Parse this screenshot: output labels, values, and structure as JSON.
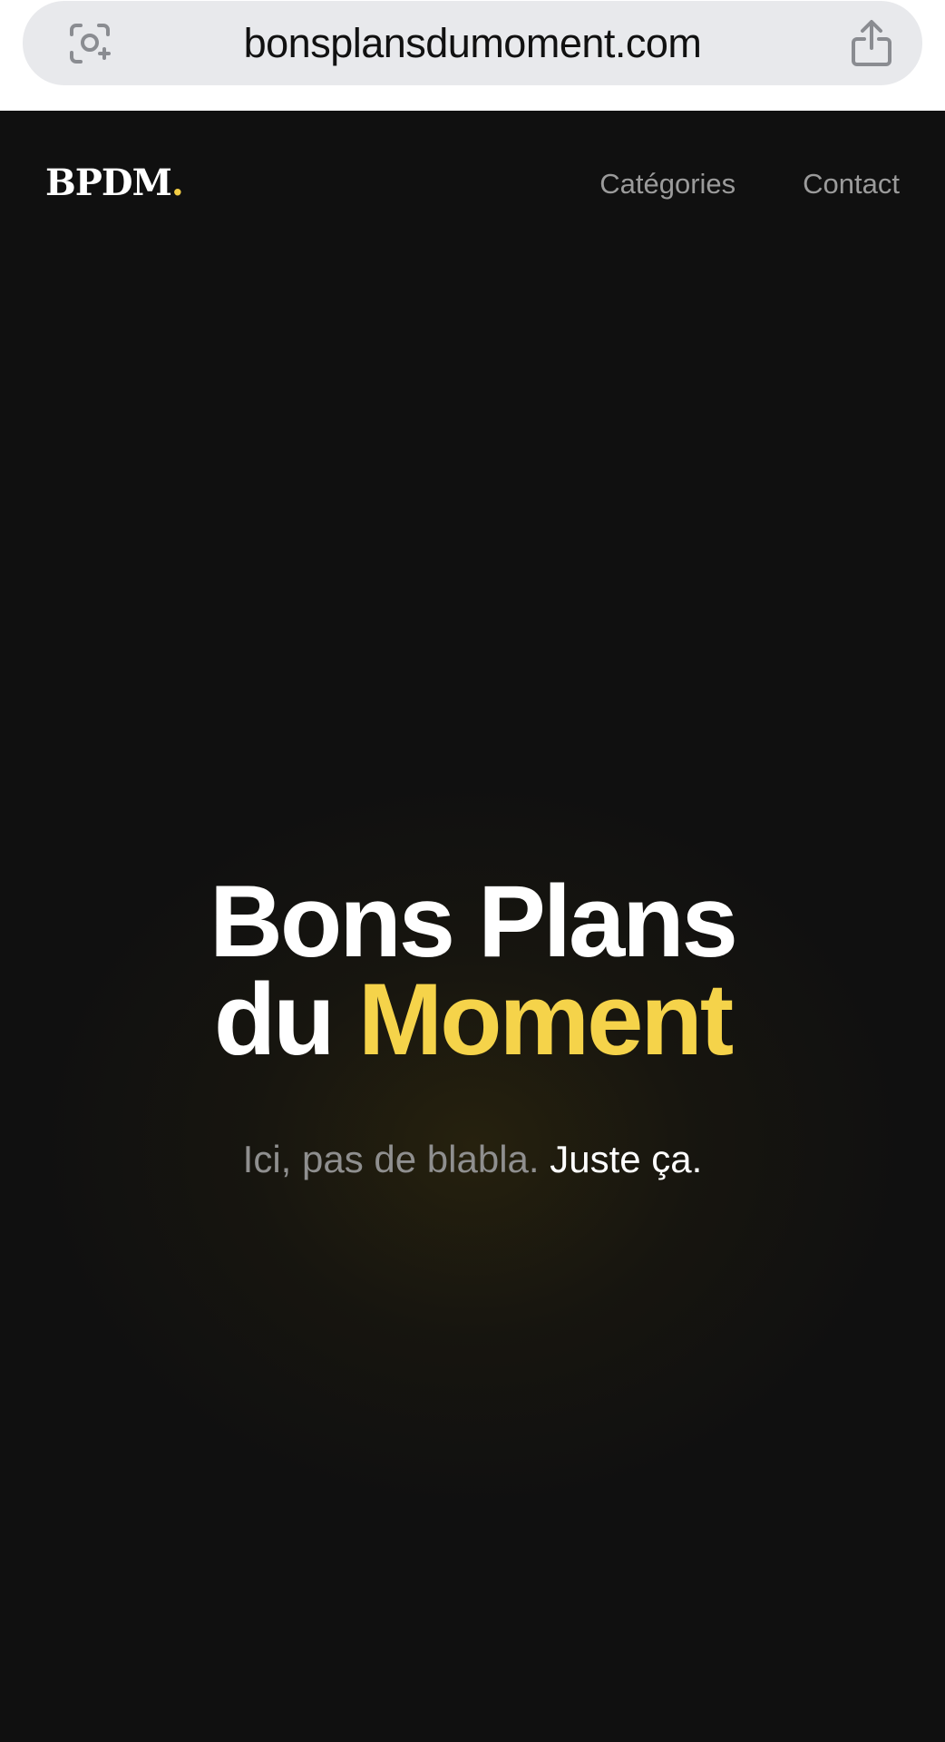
{
  "browser": {
    "url": "bonsplansdumoment.com",
    "lens_icon": "visual-lookup-icon",
    "share_icon": "share-icon"
  },
  "header": {
    "logo_text": "BPDM",
    "logo_dot": ".",
    "nav": [
      {
        "label": "Catégories"
      },
      {
        "label": "Contact"
      }
    ]
  },
  "hero": {
    "title_line1": "Bons Plans",
    "title_line2_prefix": "du",
    "title_line2_accent": "Moment",
    "subtitle_muted": "Ici, pas de blabla.",
    "subtitle_emphasis": "Juste ça."
  },
  "colors": {
    "accent": "#f5d34a",
    "background": "#101010",
    "muted_text": "#8f8f8f",
    "url_bar": "#e8e9ec"
  }
}
